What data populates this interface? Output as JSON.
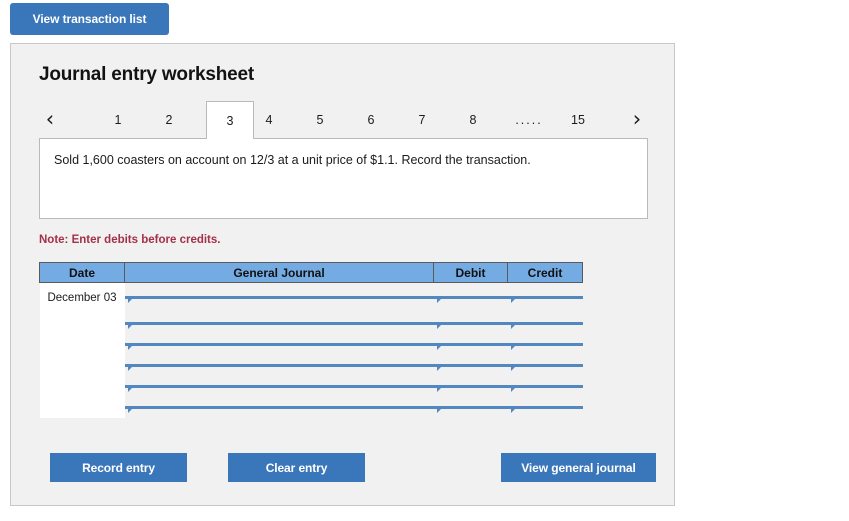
{
  "top_bar": {
    "view_transaction_list_label": "View transaction list"
  },
  "panel": {
    "title": "Journal entry worksheet",
    "prev_arrow_glyph": "‹",
    "next_arrow_glyph": "›",
    "tabs": [
      {
        "label": "1",
        "active": false
      },
      {
        "label": "2",
        "active": false
      },
      {
        "label": "3",
        "active": true
      },
      {
        "label": "4",
        "active": false
      },
      {
        "label": "5",
        "active": false
      },
      {
        "label": "6",
        "active": false
      },
      {
        "label": "7",
        "active": false
      },
      {
        "label": "8",
        "active": false
      },
      {
        "label": ".....",
        "active": false
      },
      {
        "label": "15",
        "active": false
      }
    ],
    "description": "Sold 1,600 coasters on account on 12/3 at a unit price of $1.1. Record the transaction.",
    "note": "Note: Enter debits before credits."
  },
  "journal_table": {
    "columns": [
      "Date",
      "General Journal",
      "Debit",
      "Credit"
    ],
    "rows": [
      {
        "date": "December 03",
        "general_journal": "",
        "debit": "",
        "credit": ""
      },
      {
        "date": "",
        "general_journal": "",
        "debit": "",
        "credit": ""
      },
      {
        "date": "",
        "general_journal": "",
        "debit": "",
        "credit": ""
      },
      {
        "date": "",
        "general_journal": "",
        "debit": "",
        "credit": ""
      },
      {
        "date": "",
        "general_journal": "",
        "debit": "",
        "credit": ""
      },
      {
        "date": "",
        "general_journal": "",
        "debit": "",
        "credit": ""
      }
    ]
  },
  "actions": {
    "record_entry_label": "Record entry",
    "clear_entry_label": "Clear entry",
    "view_general_journal_label": "View general journal"
  },
  "colors": {
    "button_blue": "#3a76ba",
    "table_header_blue": "#74abe2",
    "cell_border_blue": "#5387c0",
    "panel_background": "#f1f1f1",
    "note_red": "#a53049"
  }
}
